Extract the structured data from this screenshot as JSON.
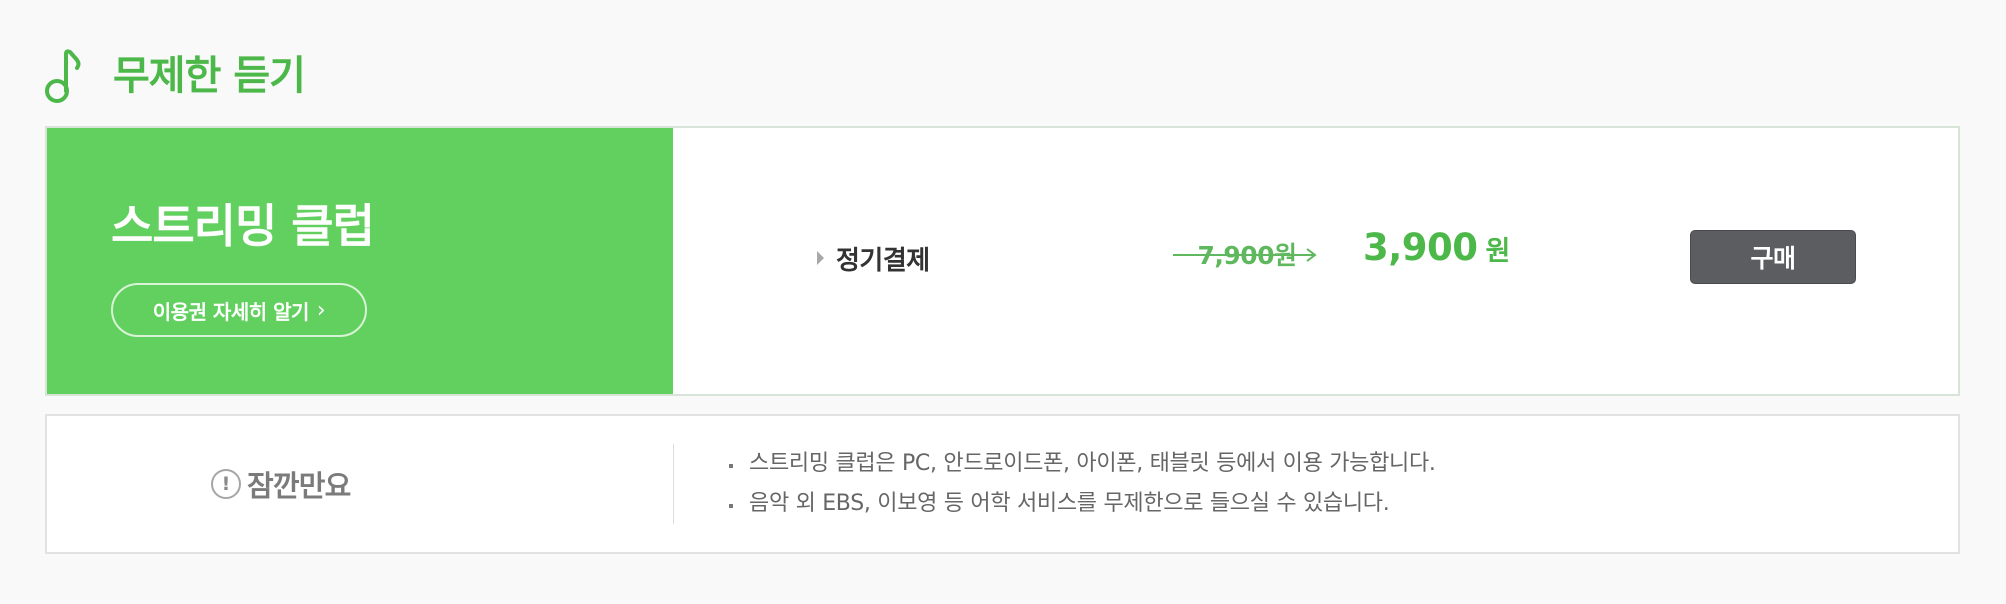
{
  "section": {
    "title": "무제한 듣기",
    "icon": "music-note-icon",
    "accent_color": "#4db84a"
  },
  "product": {
    "name": "스트리밍 클럽",
    "detail_link_label": "이용권 자세히 알기",
    "detail_link_chevron": "›",
    "panel_color": "#62d05f",
    "billing_label": "정기결제",
    "original_price": "7,900원",
    "sale_price_amount": "3,900",
    "sale_price_unit": "원",
    "buy_label": "구매"
  },
  "notice": {
    "icon": "exclamation-circle-icon",
    "icon_glyph": "!",
    "title": "잠깐만요",
    "items": [
      "스트리밍 클럽은 PC, 안드로이드폰, 아이폰, 태블릿 등에서 이용 가능합니다.",
      "음악 외 EBS, 이보영 등 어학 서비스를 무제한으로 들으실 수 있습니다."
    ]
  }
}
